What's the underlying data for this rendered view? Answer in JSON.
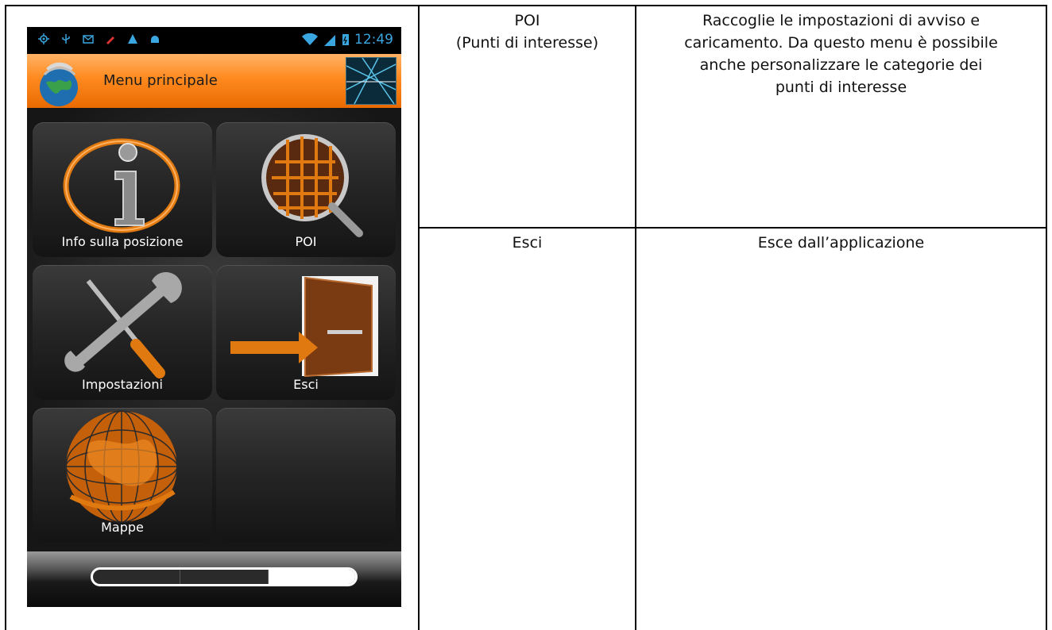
{
  "phone": {
    "status_bar": {
      "time": "12:49",
      "left_icons": [
        "gps-icon",
        "usb-icon",
        "mail-icon",
        "pen-icon",
        "warning-icon",
        "android-icon"
      ],
      "right_icons": [
        "wifi-icon",
        "signal-icon",
        "battery-icon"
      ]
    },
    "title_bar": {
      "title": "Menu principale"
    },
    "menu_tiles": [
      {
        "label": "Info sulla posizione",
        "icon": "info-icon"
      },
      {
        "label": "POI",
        "icon": "magnifier-icon"
      },
      {
        "label": "Impostazioni",
        "icon": "tools-icon"
      },
      {
        "label": "Esci",
        "icon": "exit-door-icon"
      },
      {
        "label": "Mappe",
        "icon": "globe-icon"
      },
      {
        "label": "",
        "icon": ""
      }
    ],
    "pager": {
      "pages": 3,
      "active_page": 3
    }
  },
  "table": {
    "rows": [
      {
        "name_lines": [
          "POI",
          "(Punti di interesse)"
        ],
        "description_lines": [
          "Raccoglie le impostazioni di avviso e",
          "caricamento. Da questo menu è possibile",
          "anche personalizzare le categorie dei",
          "punti di interesse"
        ]
      },
      {
        "name_lines": [
          "Esci"
        ],
        "description_lines": [
          "Esce dall’applicazione"
        ]
      }
    ]
  },
  "colors": {
    "title_bar_orange": "#ff8a1f",
    "status_blue": "#3aa6e0",
    "accent_orange": "#e86a00"
  }
}
